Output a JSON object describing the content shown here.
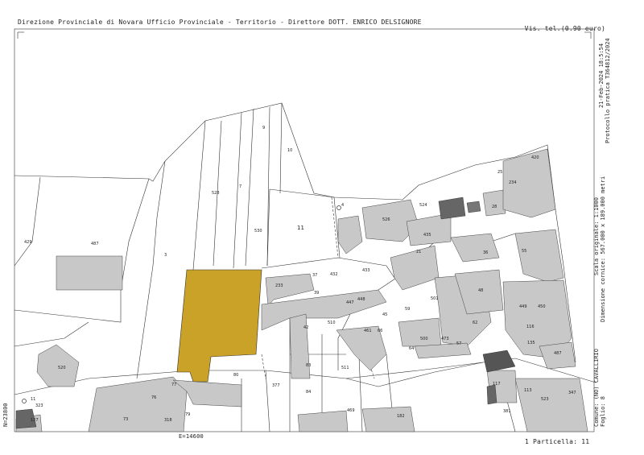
{
  "header": {
    "left_text": "Direzione Provinciale di Novara  Ufficio Provinciale - Territorio - Direttore DOTT. ENRICO DELSIGNORE",
    "right_text": "Vis. tel.(0.90 euro)"
  },
  "side_meta": {
    "timestamp": "21-Feb-2024 18:5:54",
    "protocol": "Protocollo pratica T364812/2024",
    "scale": "Scala originale: 1:1000",
    "frame_dims": "Dimensione cornice: 567.000 x 189.000 metri",
    "comune": "Comune: (NO) CAVALLIRIO",
    "foglio": "Foglio: 8"
  },
  "coords": {
    "north": "N=23800",
    "east": "E=14600"
  },
  "footer": {
    "particella": "1 Particella: 11"
  },
  "map": {
    "colors": {
      "highlight": "#c9a227",
      "building": "#c8c8c8",
      "line": "#333333"
    },
    "parcel_labels": [
      {
        "id": "p-429",
        "text": "429"
      },
      {
        "id": "p-487",
        "text": "487"
      },
      {
        "id": "p-3",
        "text": "3"
      },
      {
        "id": "p-528",
        "text": "528"
      },
      {
        "id": "p-7",
        "text": "7"
      },
      {
        "id": "p-9",
        "text": "9"
      },
      {
        "id": "p-10",
        "text": "10"
      },
      {
        "id": "p-530",
        "text": "530"
      },
      {
        "id": "p-11",
        "text": "11"
      },
      {
        "id": "p-4",
        "text": "4"
      },
      {
        "id": "p-520",
        "text": "520"
      },
      {
        "id": "p-233",
        "text": "233"
      },
      {
        "id": "p-37",
        "text": "37"
      },
      {
        "id": "p-432",
        "text": "432"
      },
      {
        "id": "p-433",
        "text": "433"
      },
      {
        "id": "p-39",
        "text": "39"
      },
      {
        "id": "p-447",
        "text": "447"
      },
      {
        "id": "p-448",
        "text": "448"
      },
      {
        "id": "p-42",
        "text": "42"
      },
      {
        "id": "p-510",
        "text": "510"
      },
      {
        "id": "p-45",
        "text": "45"
      },
      {
        "id": "p-59",
        "text": "59"
      },
      {
        "id": "p-83",
        "text": "83"
      },
      {
        "id": "p-84",
        "text": "84"
      },
      {
        "id": "p-511",
        "text": "511"
      },
      {
        "id": "p-377",
        "text": "377"
      },
      {
        "id": "p-80",
        "text": "80"
      },
      {
        "id": "p-77",
        "text": "77"
      },
      {
        "id": "p-76",
        "text": "76"
      },
      {
        "id": "p-73",
        "text": "73"
      },
      {
        "id": "p-79",
        "text": "79"
      },
      {
        "id": "p-318",
        "text": "318"
      },
      {
        "id": "p-524",
        "text": "524"
      },
      {
        "id": "p-21",
        "text": "21"
      },
      {
        "id": "p-48",
        "text": "48"
      },
      {
        "id": "p-55",
        "text": "55"
      },
      {
        "id": "p-116",
        "text": "116"
      },
      {
        "id": "p-487b",
        "text": "487"
      },
      {
        "id": "p-523",
        "text": "523"
      },
      {
        "id": "p-347",
        "text": "347"
      },
      {
        "id": "p-420",
        "text": "420"
      },
      {
        "id": "p-25",
        "text": "25"
      },
      {
        "id": "p-234",
        "text": "234"
      },
      {
        "id": "p-28",
        "text": "28"
      },
      {
        "id": "p-526",
        "text": "526"
      },
      {
        "id": "p-435",
        "text": "435"
      },
      {
        "id": "p-127",
        "text": "127"
      },
      {
        "id": "p-323",
        "text": "323"
      },
      {
        "id": "p-11b",
        "text": "11"
      },
      {
        "id": "p-469",
        "text": "469"
      },
      {
        "id": "p-182",
        "text": "182"
      },
      {
        "id": "p-381",
        "text": "381"
      },
      {
        "id": "p-501",
        "text": "501"
      },
      {
        "id": "p-62",
        "text": "62"
      },
      {
        "id": "p-66",
        "text": "66"
      },
      {
        "id": "p-473",
        "text": "473"
      },
      {
        "id": "p-500",
        "text": "500"
      },
      {
        "id": "p-449",
        "text": "449"
      },
      {
        "id": "p-450",
        "text": "450"
      },
      {
        "id": "p-135",
        "text": "135"
      },
      {
        "id": "p-461",
        "text": "461"
      },
      {
        "id": "p-57",
        "text": "57"
      },
      {
        "id": "p-64",
        "text": "64"
      },
      {
        "id": "p-117",
        "text": "117"
      },
      {
        "id": "p-113",
        "text": "113"
      },
      {
        "id": "p-36",
        "text": "36"
      }
    ]
  }
}
